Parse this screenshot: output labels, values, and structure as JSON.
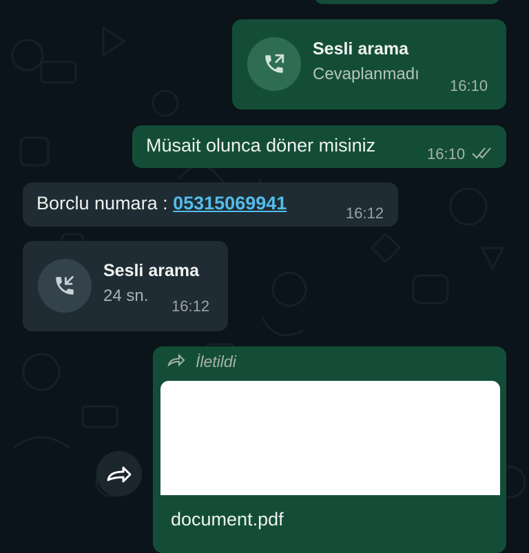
{
  "messages": {
    "call_out": {
      "title": "Sesli arama",
      "status": "Cevaplanmadı",
      "time": "16:10",
      "icon": "outgoing-call-icon"
    },
    "text_out": {
      "text": "Müsait olunca döner misiniz",
      "time": "16:10",
      "ticks": "double-check-icon"
    },
    "text_in": {
      "prefix": "Borclu numara : ",
      "phone": "05315069941",
      "time": "16:12"
    },
    "call_in": {
      "title": "Sesli arama",
      "duration": "24 sn.",
      "time": "16:12",
      "icon": "incoming-call-icon"
    },
    "forwarded_doc": {
      "forwarded_label": "İletildi",
      "file_name": "document.pdf",
      "forward_action_icon": "share-arrow-icon"
    }
  },
  "colors": {
    "background": "#0b141a",
    "outgoing_bubble": "#144d37",
    "incoming_bubble": "#202c33",
    "link": "#53bdeb"
  }
}
